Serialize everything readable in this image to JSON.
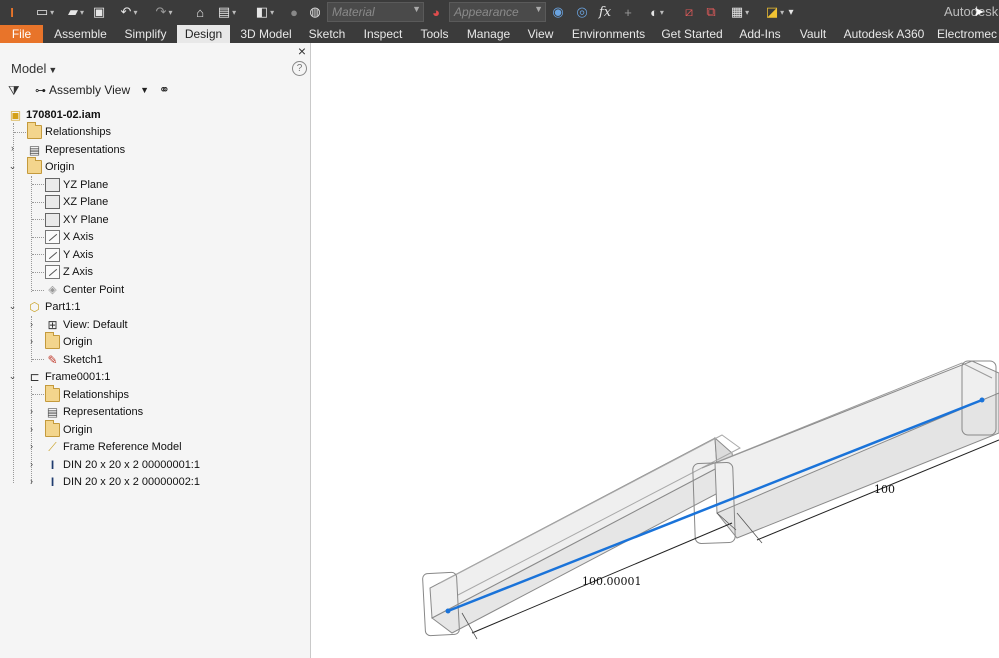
{
  "app": {
    "title": "Autodesk I"
  },
  "quick_access": {
    "material_placeholder": "Material",
    "appearance_placeholder": "Appearance",
    "fx_label": "fx"
  },
  "tabs": [
    "File",
    "Assemble",
    "Simplify",
    "Design",
    "3D Model",
    "Sketch",
    "Inspect",
    "Tools",
    "Manage",
    "View",
    "Environments",
    "Get Started",
    "Add-Ins",
    "Vault",
    "Autodesk A360",
    "Electromec"
  ],
  "active_tab": "Design",
  "browser": {
    "title": "Model",
    "help": "?",
    "view_mode": "Assembly View",
    "close": "×",
    "tree": [
      {
        "label": "170801-02.iam",
        "icon": "assembly-icon"
      },
      {
        "label": "Relationships",
        "icon": "folder-icon"
      },
      {
        "label": "Representations",
        "icon": "representations-icon"
      },
      {
        "label": "Origin",
        "icon": "folder-open-icon"
      },
      {
        "label": "YZ Plane",
        "icon": "plane-icon"
      },
      {
        "label": "XZ Plane",
        "icon": "plane-icon"
      },
      {
        "label": "XY Plane",
        "icon": "plane-icon"
      },
      {
        "label": "X Axis",
        "icon": "axis-icon"
      },
      {
        "label": "Y Axis",
        "icon": "axis-icon"
      },
      {
        "label": "Z Axis",
        "icon": "axis-icon"
      },
      {
        "label": "Center Point",
        "icon": "point-icon"
      },
      {
        "label": "Part1:1",
        "icon": "part-icon"
      },
      {
        "label": "View: Default",
        "icon": "view-icon"
      },
      {
        "label": "Origin",
        "icon": "folder-icon"
      },
      {
        "label": "Sketch1",
        "icon": "sketch-icon"
      },
      {
        "label": "Frame0001:1",
        "icon": "frame-icon"
      },
      {
        "label": "Relationships",
        "icon": "folder-icon"
      },
      {
        "label": "Representations",
        "icon": "representations-icon"
      },
      {
        "label": "Origin",
        "icon": "folder-icon"
      },
      {
        "label": "Frame Reference Model",
        "icon": "frame-reference-icon"
      },
      {
        "label": "DIN 20 x 20 x 2 00000001:1",
        "icon": "beam-icon"
      },
      {
        "label": "DIN 20 x 20 x 2 00000002:1",
        "icon": "beam-icon"
      }
    ]
  },
  "viewport": {
    "dimension_1": "100.00001",
    "dimension_2": "100"
  },
  "colors": {
    "file_tab": "#e8742a",
    "toolbar_bg": "#3b3b3b",
    "sketch_line": "#1a73d9"
  }
}
